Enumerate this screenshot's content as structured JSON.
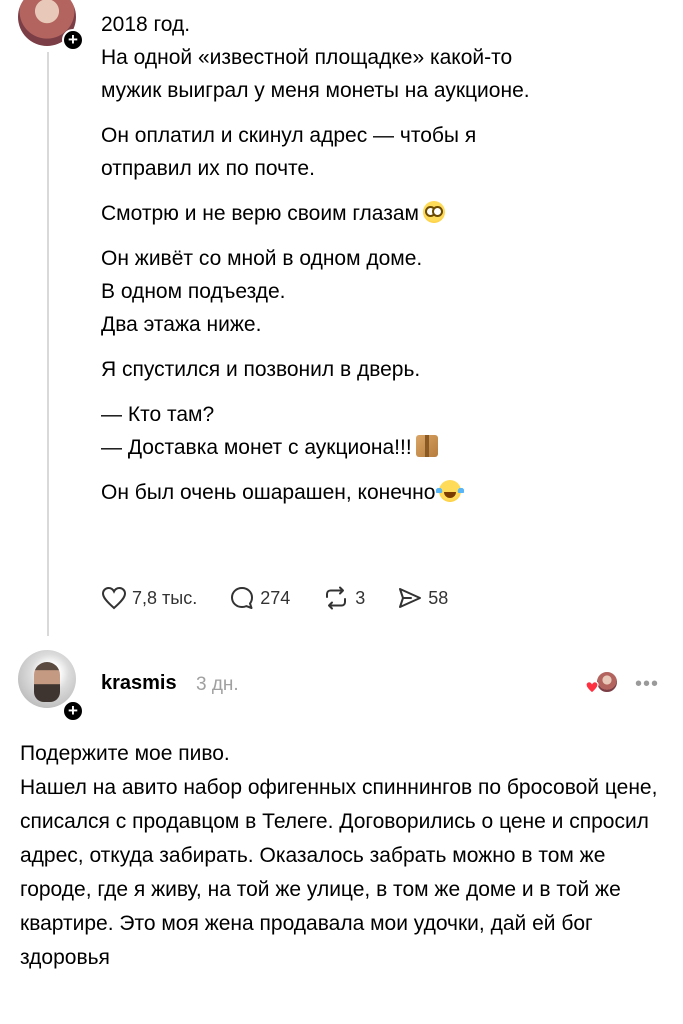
{
  "post1": {
    "lines": [
      "2018 год.",
      "На одной «известной площадке» какой-то\nмужик выиграл у меня монеты на аукционе.",
      "Он оплатил и скинул адрес — чтобы я\nотправил их по почте.",
      "Смотрю и не верю своим глазам",
      "Он живёт со мной в одном доме.\nВ одном подъезде.\nДва этажа ниже.",
      "Я спустился и позвонил в дверь.",
      "— Кто там?\n— Доставка монет с аукциона!!!",
      "Он был очень ошарашен, конечно"
    ],
    "emojis": [
      "flushed-face",
      "package",
      "tears-of-joy"
    ],
    "stats": {
      "likes": "7,8 тыс.",
      "comments": "274",
      "reposts": "3",
      "shares": "58"
    }
  },
  "post2": {
    "username": "krasmis",
    "time": "3 дн.",
    "text": "Подержите мое пиво.\nНашел на авито набор офигенных спиннингов по бросовой цене, списался с продавцом в Телеге. Договорились о цене и спросил адрес, откуда забирать. Оказалось забрать можно в том же городе, где я живу, на той же улице, в том же доме и в той же квартире. Это моя жена продавала мои удочки, дай ей бог здоровья"
  },
  "colors": {
    "text": "#000000",
    "muted": "#a0a0a0",
    "heart": "#ff3040"
  }
}
